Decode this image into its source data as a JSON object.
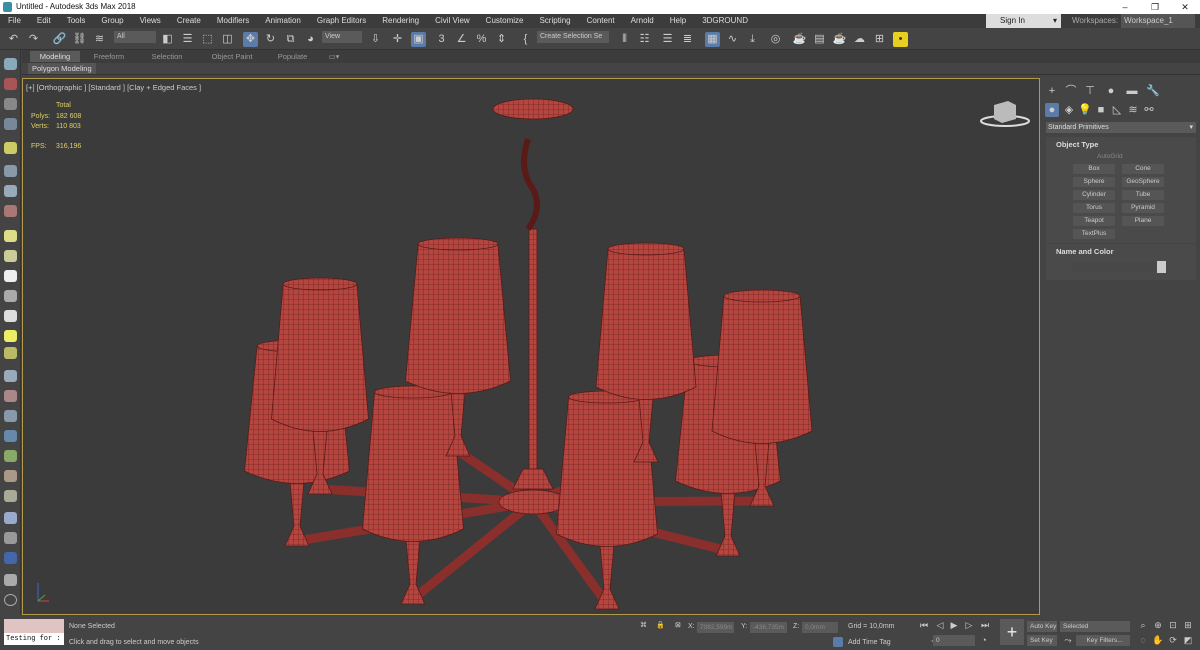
{
  "window": {
    "title": "Untitled - Autodesk 3ds Max 2018",
    "minimize": "–",
    "restore": "❐",
    "close": "✕"
  },
  "menu": [
    "File",
    "Edit",
    "Tools",
    "Group",
    "Views",
    "Create",
    "Modifiers",
    "Animation",
    "Graph Editors",
    "Rendering",
    "Civil View",
    "Customize",
    "Scripting",
    "Content",
    "Arnold",
    "Help",
    "3DGROUND"
  ],
  "account": {
    "sign_in": "Sign In",
    "workspaces_label": "Workspaces:",
    "workspace": "Workspace_1"
  },
  "toolbar": {
    "filter": "All",
    "ref_coord": "View",
    "selection_set": "Create Selection Se"
  },
  "ribbon": {
    "tabs": [
      "Modeling",
      "Freeform",
      "Selection",
      "Object Paint",
      "Populate"
    ],
    "active": "Modeling",
    "sub": "Polygon Modeling"
  },
  "viewport": {
    "label": "[+] [Orthographic ] [Standard ] [Clay + Edged Faces ]",
    "stats": {
      "total_label": "Total",
      "polys_label": "Polys:",
      "polys": "182 608",
      "verts_label": "Verts:",
      "verts": "110 803",
      "fps_label": "FPS:",
      "fps": "316,196"
    },
    "model_color": "#b5453f",
    "border_color": "#b39a4a"
  },
  "panel": {
    "category": "Standard Primitives",
    "object_type": "Object Type",
    "autogrid": "AutoGrid",
    "buttons": [
      "Box",
      "Cone",
      "Sphere",
      "GeoSphere",
      "Cylinder",
      "Tube",
      "Torus",
      "Pyramid",
      "Teapot",
      "Plane",
      "TextPlus"
    ],
    "name_color": "Name and Color"
  },
  "status": {
    "maxscript": "Testing for :",
    "selection": "None Selected",
    "prompt": "Click and drag to select and move objects",
    "x_label": "X:",
    "x": "7082,599m",
    "y_label": "Y:",
    "y": "-436,735m",
    "z_label": "Z:",
    "z": "0,0mm",
    "grid": "Grid = 10,0mm",
    "add_time_tag": "Add Time Tag",
    "frame": "0",
    "auto_key": "Auto Key",
    "set_key": "Set Key",
    "key_mode": "Selected",
    "key_filters": "Key Filters..."
  }
}
